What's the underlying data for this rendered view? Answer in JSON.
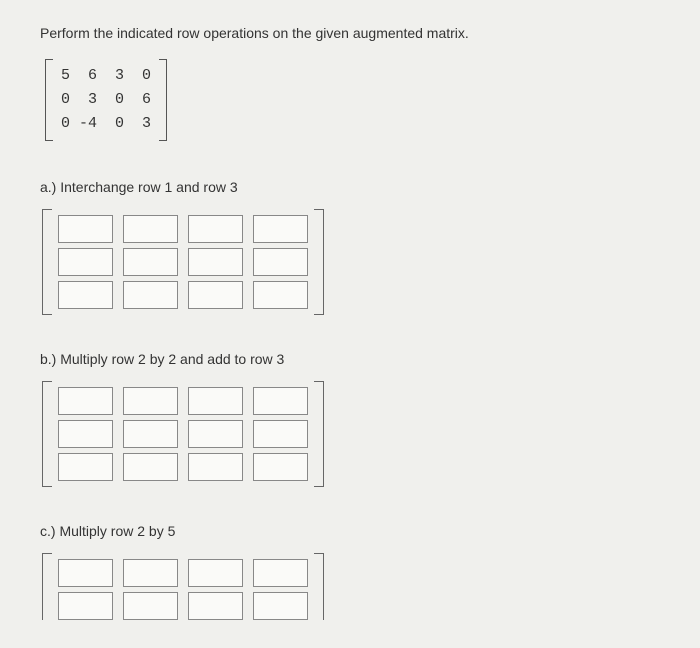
{
  "instruction": "Perform the indicated row operations on the given augmented matrix.",
  "matrix": {
    "row1": "5  6  3  0",
    "row2": "0  3  0  6",
    "row3": "0 -4  0  3"
  },
  "parts": {
    "a": {
      "label": "a.) Interchange row 1 and row 3"
    },
    "b": {
      "label": "b.) Multiply row 2 by 2 and add to row 3"
    },
    "c": {
      "label": "c.) Multiply row 2 by 5"
    }
  }
}
